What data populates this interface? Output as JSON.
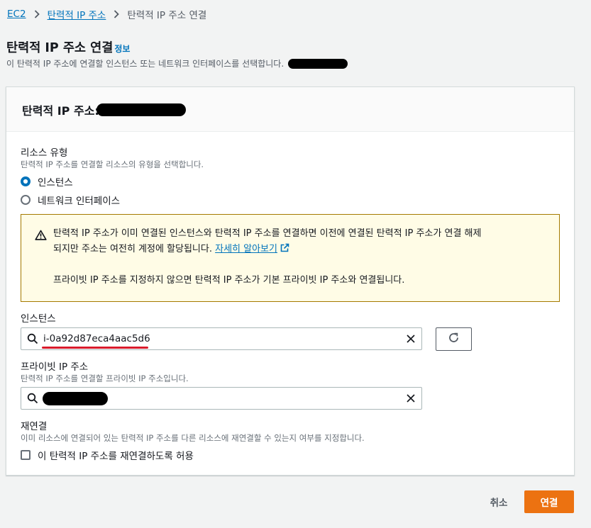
{
  "breadcrumb": {
    "items": [
      "EC2",
      "탄력적 IP 주소",
      "탄력적 IP 주소 연결"
    ]
  },
  "header": {
    "title": "탄력적 IP 주소 연결",
    "info_link": "정보",
    "description": "이 탄력적 IP 주소에 연결할 인스턴스 또는 네트워크 인터페이스를 선택합니다."
  },
  "panel": {
    "title": "탄력적 IP 주소:"
  },
  "resource_type": {
    "label": "리소스 유형",
    "description": "탄력적 IP 주소를 연결할 리소스의 유형을 선택합니다.",
    "options": [
      "인스턴스",
      "네트워크 인터페이스"
    ],
    "selected": "인스턴스"
  },
  "warning": {
    "line1": "탄력적 IP 주소가 이미 연결된 인스턴스와 탄력적 IP 주소를 연결하면 이전에 연결된 탄력적 IP 주소가 연결 해제",
    "line2": "되지만 주소는 여전히 계정에 할당됩니다.",
    "link": "자세히 알아보기",
    "line3": "프라이빗 IP 주소를 지정하지 않으면 탄력적 IP 주소가 기본 프라이빗 IP 주소와 연결됩니다."
  },
  "instance": {
    "label": "인스턴스",
    "value": "i-0a92d87eca4aac5d6"
  },
  "private_ip": {
    "label": "프라이빗 IP 주소",
    "description": "탄력적 IP 주소를 연결할 프라이빗 IP 주소입니다."
  },
  "reassociation": {
    "label": "재연결",
    "description": "이미 리소스에 연결되어 있는 탄력적 IP 주소를 다른 리소스에 재연결할 수 있는지 여부를 지정합니다.",
    "checkbox_label": "이 탄력적 IP 주소를 재연결하도록 허용",
    "checked": false
  },
  "footer": {
    "cancel_label": "취소",
    "submit_label": "연결"
  },
  "colors": {
    "link": "#0073bb",
    "primary": "#ec7211",
    "warning_bg": "#fffce6",
    "warning_border": "#a57a00",
    "annotation_underline": "#d91b2b"
  }
}
